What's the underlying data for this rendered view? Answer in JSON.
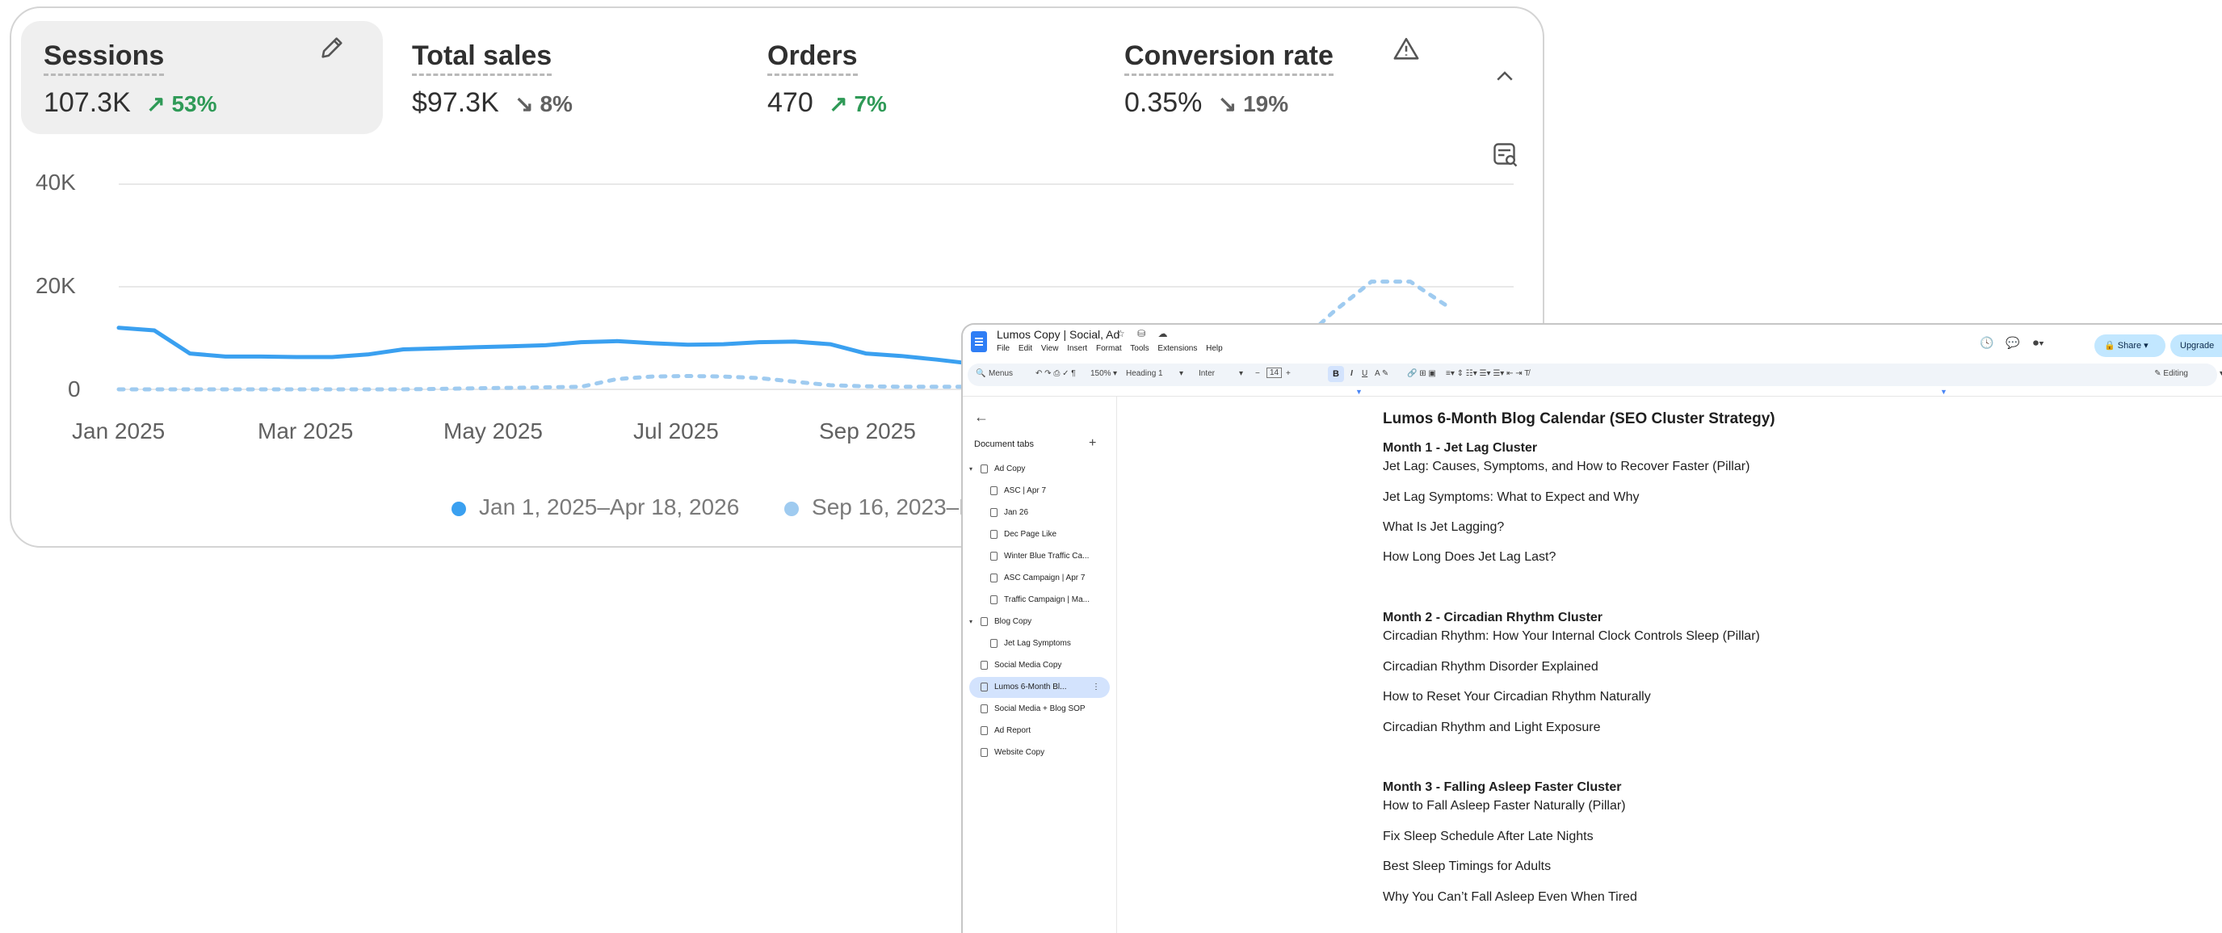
{
  "analytics": {
    "metrics": [
      {
        "label": "Sessions",
        "value": "107.3K",
        "delta": "53%",
        "direction": "up"
      },
      {
        "label": "Total sales",
        "value": "$97.3K",
        "delta": "8%",
        "direction": "down"
      },
      {
        "label": "Orders",
        "value": "470",
        "delta": "7%",
        "direction": "up"
      },
      {
        "label": "Conversion rate",
        "value": "0.35%",
        "delta": "19%",
        "direction": "down"
      }
    ],
    "icons": {
      "edit": "pencil-icon",
      "warning": "warning-icon",
      "collapse": "chevron-up-icon",
      "filter": "table-search-icon"
    }
  },
  "chart_data": {
    "type": "line",
    "ylabels": [
      "40K",
      "20K",
      "0"
    ],
    "xlabels": [
      "Jan 2025",
      "Mar 2025",
      "May 2025",
      "Jul 2025",
      "Sep 2025"
    ],
    "ylim": [
      0,
      40000
    ],
    "grid": true,
    "legend_position": "bottom",
    "series": [
      {
        "name": "Jan 1, 2025–Apr 18, 2026",
        "color": "#3aa0f0",
        "style": "solid",
        "values": [
          12000,
          11500,
          7000,
          6400,
          6400,
          6300,
          6300,
          6800,
          7800,
          8000,
          8200,
          8400,
          8600,
          9200,
          9400,
          9000,
          8700,
          8800,
          9200,
          9300,
          8800,
          7000,
          6500,
          5800,
          5000
        ]
      },
      {
        "name": "Sep 16, 2023–D",
        "color": "#9fcbf0",
        "style": "dashed",
        "values": [
          0,
          0,
          0,
          0,
          0,
          0,
          0,
          0,
          0,
          100,
          200,
          300,
          400,
          500,
          2000,
          2500,
          2600,
          2500,
          2200,
          1500,
          800,
          600,
          500,
          500,
          500
        ]
      },
      {
        "name": "",
        "color": "#9fcbf0",
        "style": "dashed",
        "partial": true,
        "values": [
          5000,
          8000,
          15000,
          21000,
          21000,
          16000
        ]
      }
    ]
  },
  "doc": {
    "title": "Lumos Copy | Social, Ad",
    "title_icons": "☆ ⛁ ☁",
    "menus": [
      "File",
      "Edit",
      "View",
      "Insert",
      "Format",
      "Tools",
      "Extensions",
      "Help"
    ],
    "share_label": "Share",
    "upgrade_label": "Upgrade",
    "toolbar": {
      "menus_label": "Menus",
      "zoom": "150%",
      "style": "Heading 1",
      "font": "Inter",
      "size": "14",
      "mode": "Editing"
    },
    "tabs_header": "Document tabs",
    "tabs": [
      {
        "label": "Ad Copy",
        "level": 0,
        "expanded": true
      },
      {
        "label": "ASC | Apr 7",
        "level": 1
      },
      {
        "label": "Jan 26",
        "level": 1
      },
      {
        "label": "Dec Page Like",
        "level": 1
      },
      {
        "label": "Winter Blue Traffic Ca...",
        "level": 1
      },
      {
        "label": "ASC Campaign | Apr 7",
        "level": 1
      },
      {
        "label": "Traffic Campaign | Ma...",
        "level": 1
      },
      {
        "label": "Blog Copy",
        "level": 0,
        "expanded": true
      },
      {
        "label": "Jet Lag Symptoms",
        "level": 1
      },
      {
        "label": "Social Media Copy",
        "level": 0
      },
      {
        "label": "Lumos 6-Month Bl...",
        "level": 0,
        "selected": true
      },
      {
        "label": "Social Media + Blog SOP",
        "level": 0
      },
      {
        "label": "Ad Report",
        "level": 0
      },
      {
        "label": "Website Copy",
        "level": 0
      }
    ],
    "content": [
      {
        "text": "Lumos 6-Month Blog Calendar (SEO Cluster Strategy)",
        "kind": "h1"
      },
      {
        "text": "Month 1 - Jet Lag Cluster",
        "kind": "h2"
      },
      {
        "text": "Jet Lag: Causes, Symptoms, and How to Recover Faster (Pillar)",
        "kind": "p"
      },
      {
        "text": "Jet Lag Symptoms: What to Expect and Why",
        "kind": "p"
      },
      {
        "text": "What Is Jet Lagging?",
        "kind": "p"
      },
      {
        "text": "How Long Does Jet Lag Last?",
        "kind": "p"
      },
      {
        "text": "Month 2 - Circadian Rhythm Cluster",
        "kind": "h2"
      },
      {
        "text": "Circadian Rhythm: How Your Internal Clock Controls Sleep (Pillar)",
        "kind": "p"
      },
      {
        "text": "Circadian Rhythm Disorder Explained",
        "kind": "p"
      },
      {
        "text": "How to Reset Your Circadian Rhythm Naturally",
        "kind": "p"
      },
      {
        "text": "Circadian Rhythm and Light Exposure",
        "kind": "p"
      },
      {
        "text": "Month 3 - Falling Asleep Faster Cluster",
        "kind": "h2"
      },
      {
        "text": "How to Fall Asleep Faster Naturally (Pillar)",
        "kind": "p"
      },
      {
        "text": "Fix Sleep Schedule After Late Nights",
        "kind": "p"
      },
      {
        "text": "Best Sleep Timings for Adults",
        "kind": "p"
      },
      {
        "text": "Why You Can’t Fall Asleep Even When Tired",
        "kind": "p"
      }
    ]
  }
}
